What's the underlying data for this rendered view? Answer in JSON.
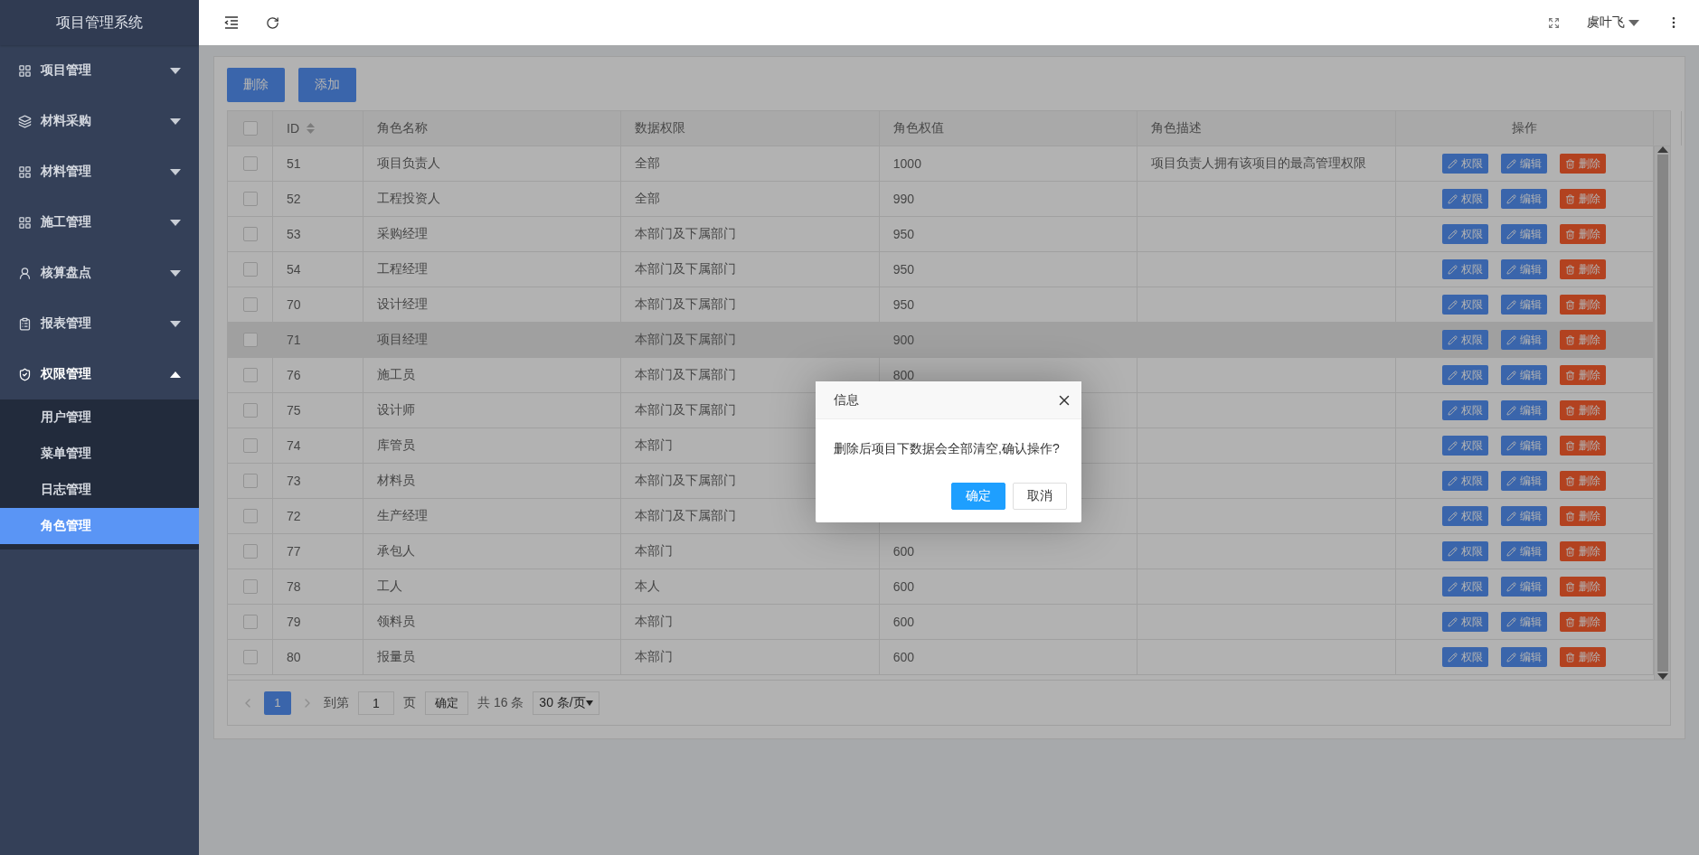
{
  "sidebar": {
    "title": "项目管理系统",
    "items": [
      {
        "label": "项目管理",
        "expanded": false
      },
      {
        "label": "材料采购",
        "expanded": false
      },
      {
        "label": "材料管理",
        "expanded": false
      },
      {
        "label": "施工管理",
        "expanded": false
      },
      {
        "label": "核算盘点",
        "expanded": false
      },
      {
        "label": "报表管理",
        "expanded": false
      },
      {
        "label": "权限管理",
        "expanded": true,
        "children": [
          {
            "label": "用户管理",
            "selected": false
          },
          {
            "label": "菜单管理",
            "selected": false
          },
          {
            "label": "日志管理",
            "selected": false
          },
          {
            "label": "角色管理",
            "selected": true
          }
        ]
      }
    ]
  },
  "topbar": {
    "user": "虞叶飞"
  },
  "toolbar": {
    "buttons": [
      "删除",
      "添加"
    ]
  },
  "table": {
    "select_all": {
      "checked": false
    },
    "columns": [
      {
        "label": "ID",
        "sortable": true
      },
      {
        "label": "角色名称",
        "sortable": false
      },
      {
        "label": "数据权限",
        "sortable": false
      },
      {
        "label": "角色权值",
        "sortable": false
      },
      {
        "label": "角色描述",
        "sortable": false
      },
      {
        "label": "操作",
        "sortable": false
      }
    ],
    "rows": [
      {
        "checked": false,
        "highlighted": false,
        "id": "51",
        "name": "项目负责人",
        "scope": "全部",
        "weight": "1000",
        "description": "项目负责人拥有该项目的最高管理权限",
        "actions": [
          {
            "label": "权限",
            "kind": "edit"
          },
          {
            "label": "编辑",
            "kind": "edit"
          },
          {
            "label": "删除",
            "kind": "delete"
          }
        ]
      },
      {
        "checked": false,
        "highlighted": false,
        "id": "52",
        "name": "工程投资人",
        "scope": "全部",
        "weight": "990",
        "actions": [
          {
            "label": "权限",
            "kind": "edit"
          },
          {
            "label": "编辑",
            "kind": "edit"
          },
          {
            "label": "删除",
            "kind": "delete"
          }
        ]
      },
      {
        "checked": false,
        "highlighted": false,
        "id": "53",
        "name": "采购经理",
        "scope": "本部门及下属部门",
        "weight": "950",
        "actions": [
          {
            "label": "权限",
            "kind": "edit"
          },
          {
            "label": "编辑",
            "kind": "edit"
          },
          {
            "label": "删除",
            "kind": "delete"
          }
        ]
      },
      {
        "checked": false,
        "highlighted": false,
        "id": "54",
        "name": "工程经理",
        "scope": "本部门及下属部门",
        "weight": "950",
        "actions": [
          {
            "label": "权限",
            "kind": "edit"
          },
          {
            "label": "编辑",
            "kind": "edit"
          },
          {
            "label": "删除",
            "kind": "delete"
          }
        ]
      },
      {
        "checked": false,
        "highlighted": false,
        "id": "70",
        "name": "设计经理",
        "scope": "本部门及下属部门",
        "weight": "950",
        "actions": [
          {
            "label": "权限",
            "kind": "edit"
          },
          {
            "label": "编辑",
            "kind": "edit"
          },
          {
            "label": "删除",
            "kind": "delete"
          }
        ]
      },
      {
        "checked": false,
        "highlighted": true,
        "id": "71",
        "name": "项目经理",
        "scope": "本部门及下属部门",
        "weight": "900",
        "actions": [
          {
            "label": "权限",
            "kind": "edit"
          },
          {
            "label": "编辑",
            "kind": "edit"
          },
          {
            "label": "删除",
            "kind": "delete"
          }
        ]
      },
      {
        "checked": false,
        "highlighted": false,
        "id": "76",
        "name": "施工员",
        "scope": "本部门及下属部门",
        "weight": "800",
        "actions": [
          {
            "label": "权限",
            "kind": "edit"
          },
          {
            "label": "编辑",
            "kind": "edit"
          },
          {
            "label": "删除",
            "kind": "delete"
          }
        ]
      },
      {
        "checked": false,
        "highlighted": false,
        "id": "75",
        "name": "设计师",
        "scope": "本部门及下属部门",
        "actions": [
          {
            "label": "权限",
            "kind": "edit"
          },
          {
            "label": "编辑",
            "kind": "edit"
          },
          {
            "label": "删除",
            "kind": "delete"
          }
        ]
      },
      {
        "checked": false,
        "highlighted": false,
        "id": "74",
        "name": "库管员",
        "scope": "本部门",
        "actions": [
          {
            "label": "权限",
            "kind": "edit"
          },
          {
            "label": "编辑",
            "kind": "edit"
          },
          {
            "label": "删除",
            "kind": "delete"
          }
        ]
      },
      {
        "checked": false,
        "highlighted": false,
        "id": "73",
        "name": "材料员",
        "scope": "本部门及下属部门",
        "actions": [
          {
            "label": "权限",
            "kind": "edit"
          },
          {
            "label": "编辑",
            "kind": "edit"
          },
          {
            "label": "删除",
            "kind": "delete"
          }
        ]
      },
      {
        "checked": false,
        "highlighted": false,
        "id": "72",
        "name": "生产经理",
        "scope": "本部门及下属部门",
        "actions": [
          {
            "label": "权限",
            "kind": "edit"
          },
          {
            "label": "编辑",
            "kind": "edit"
          },
          {
            "label": "删除",
            "kind": "delete"
          }
        ]
      },
      {
        "checked": false,
        "highlighted": false,
        "id": "77",
        "name": "承包人",
        "scope": "本部门",
        "weight": "600",
        "actions": [
          {
            "label": "权限",
            "kind": "edit"
          },
          {
            "label": "编辑",
            "kind": "edit"
          },
          {
            "label": "删除",
            "kind": "delete"
          }
        ]
      },
      {
        "checked": false,
        "highlighted": false,
        "id": "78",
        "name": "工人",
        "scope": "本人",
        "weight": "600",
        "actions": [
          {
            "label": "权限",
            "kind": "edit"
          },
          {
            "label": "编辑",
            "kind": "edit"
          },
          {
            "label": "删除",
            "kind": "delete"
          }
        ]
      },
      {
        "checked": false,
        "highlighted": false,
        "id": "79",
        "name": "领料员",
        "scope": "本部门",
        "weight": "600",
        "actions": [
          {
            "label": "权限",
            "kind": "edit"
          },
          {
            "label": "编辑",
            "kind": "edit"
          },
          {
            "label": "删除",
            "kind": "delete"
          }
        ]
      },
      {
        "checked": false,
        "highlighted": false,
        "id": "80",
        "name": "报量员",
        "scope": "本部门",
        "weight": "600",
        "actions": [
          {
            "label": "权限",
            "kind": "edit"
          },
          {
            "label": "编辑",
            "kind": "edit"
          },
          {
            "label": "删除",
            "kind": "delete"
          }
        ]
      }
    ]
  },
  "pagination": {
    "pages": [
      {
        "label": "1",
        "selected": true
      }
    ],
    "goto_label": "到第",
    "page_input": "1",
    "page_suffix": "页",
    "confirm": "确定",
    "total": "共 16 条",
    "page_size": "30 条/页"
  },
  "dialog": {
    "title": "信息",
    "message": "删除后项目下数据会全部清空,确认操作?",
    "buttons": [
      {
        "label": "确定",
        "kind": "primary"
      },
      {
        "label": "取消",
        "kind": "secondary"
      }
    ]
  }
}
